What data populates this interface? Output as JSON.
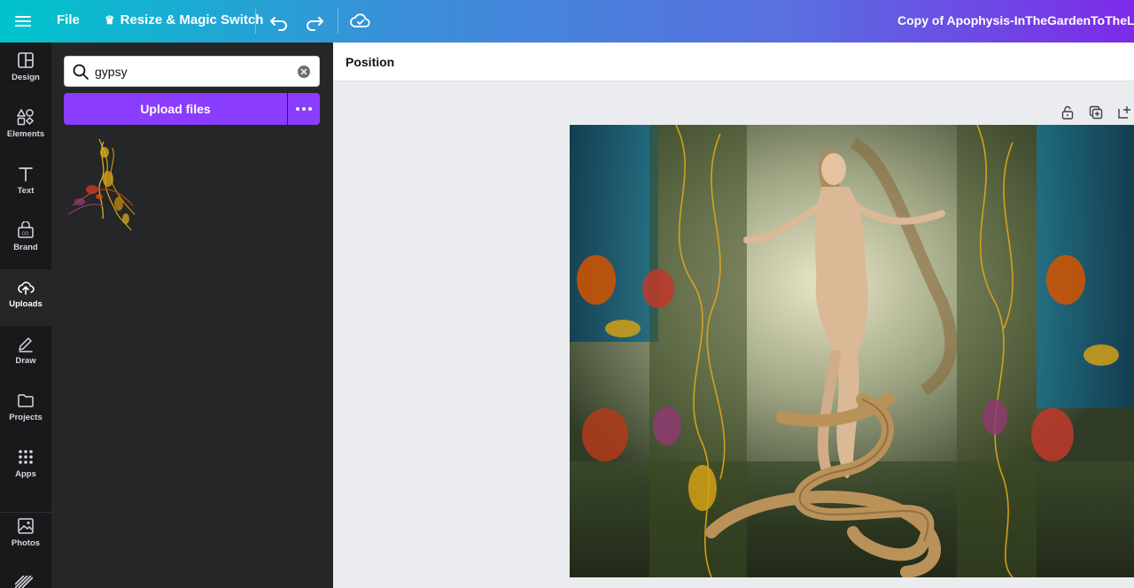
{
  "topbar": {
    "file_label": "File",
    "resize_label": "Resize & Magic Switch",
    "crown_glyph": "♛",
    "document_title": "Copy of Apophysis-InTheGardenToTheLeftOf"
  },
  "rail": {
    "items": [
      {
        "label": "Design",
        "icon": "design-icon"
      },
      {
        "label": "Elements",
        "icon": "elements-icon"
      },
      {
        "label": "Text",
        "icon": "text-icon"
      },
      {
        "label": "Brand",
        "icon": "brand-icon"
      },
      {
        "label": "Uploads",
        "icon": "uploads-icon"
      },
      {
        "label": "Draw",
        "icon": "draw-icon"
      },
      {
        "label": "Projects",
        "icon": "projects-icon"
      },
      {
        "label": "Apps",
        "icon": "apps-icon"
      },
      {
        "label": "Photos",
        "icon": "photos-icon"
      }
    ],
    "active": "Uploads"
  },
  "panel": {
    "search_value": "gypsy",
    "upload_label": "Upload files"
  },
  "context_bar": {
    "position_label": "Position"
  },
  "colors": {
    "accent": "#8b3dff",
    "rail_bg": "#18191b",
    "panel_bg": "#252627",
    "canvas_bg": "#ebecf0"
  }
}
